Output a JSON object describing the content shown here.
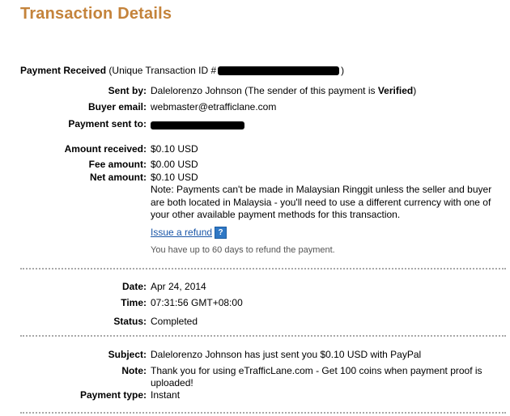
{
  "page_title": "Transaction Details",
  "payment_received": {
    "label": "Payment Received",
    "suffix": "(Unique Transaction ID #",
    "closing": ")"
  },
  "sent_by": {
    "label": "Sent by:",
    "name": "Dalelorenzo Johnson",
    "note_prefix": "(The sender of this payment is ",
    "status": "Verified",
    "note_suffix": ")"
  },
  "buyer_email": {
    "label": "Buyer email:",
    "value": "webmaster@etrafficlane.com"
  },
  "payment_sent_to": {
    "label": "Payment sent to:"
  },
  "amounts": {
    "received_label": "Amount received:",
    "received_value": "$0.10 USD",
    "fee_label": "Fee amount:",
    "fee_value": "$0.00 USD",
    "net_label": "Net amount:",
    "net_value": "$0.10 USD",
    "note": "Note: Payments can't be made in Malaysian Ringgit unless the seller and buyer are both located in Malaysia - you'll need to use a different currency with one of your other available payment methods for this transaction."
  },
  "refund": {
    "link": "Issue a refund",
    "help_icon": "?",
    "hint": "You have up to 60 days to refund the payment."
  },
  "timing": {
    "date_label": "Date:",
    "date_value": "Apr 24, 2014",
    "time_label": "Time:",
    "time_value": "07:31:56 GMT+08:00",
    "status_label": "Status:",
    "status_value": "Completed"
  },
  "details": {
    "subject_label": "Subject:",
    "subject_value": "Dalelorenzo Johnson has just sent you $0.10 USD with PayPal",
    "note_label": "Note:",
    "note_value": "Thank you for using eTrafficLane.com - Get 100 coins when payment proof is uploaded!",
    "payment_type_label": "Payment type:",
    "payment_type_value": "Instant"
  }
}
